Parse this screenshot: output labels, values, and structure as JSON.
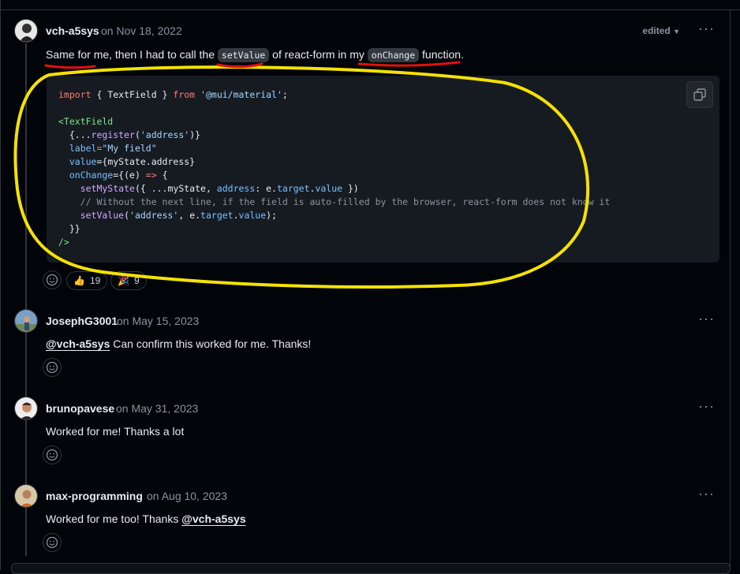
{
  "comments": [
    {
      "author": "vch-a5sys",
      "date": "on Nov 18, 2022",
      "edited_label": "edited",
      "more": "···",
      "body": {
        "part1": "Same for me",
        "part2": ", then I had to call the ",
        "code1": "setValue",
        "part3": " of react-form in my ",
        "code2": "onChange",
        "part4": " function."
      },
      "code_lines": {
        "l1_kw": "import",
        "l1_mid": " { TextField } ",
        "l1_from": "from",
        "l1_str": "'@mui/material'",
        "l1_end": ";",
        "l3": "<TextField",
        "l4_a": "  {...",
        "l4_fn": "register",
        "l4_b": "(",
        "l4_str": "'address'",
        "l4_c": ")}",
        "l5_prop": "  label",
        "l5_eq": "=",
        "l5_str": "\"My field\"",
        "l6_prop": "  value",
        "l6_rest": "={myState.address}",
        "l7_prop": "  onChange",
        "l7_rest": "={(e) ",
        "l7_arrow": "=>",
        "l7_end": " {",
        "l8_fn": "    setMyState",
        "l8_a": "({ ...myState, ",
        "l8_prop": "address",
        "l8_b": ": e.",
        "l8_prop2": "target",
        "l8_c": ".",
        "l8_prop3": "value",
        "l8_d": " })",
        "l9": "    // Without the next line, if the field is auto-filled by the browser, react-form does not know it",
        "l10_fn": "    setValue",
        "l10_a": "(",
        "l10_str": "'address'",
        "l10_b": ", e.",
        "l10_prop": "target",
        "l10_c": ".",
        "l10_prop2": "value",
        "l10_d": ");",
        "l11": "  }}",
        "l12": "/>"
      },
      "reactions": [
        {
          "emoji": "👍",
          "count": "19"
        },
        {
          "emoji": "🎉",
          "count": "9"
        }
      ]
    },
    {
      "author": "JosephG3001",
      "date": "on May 15, 2023",
      "more": "···",
      "mention": "@vch-a5sys",
      "text": " Can confirm this worked for me. Thanks!"
    },
    {
      "author": "brunopavese",
      "date": "on May 31, 2023",
      "more": "···",
      "text": "Worked for me! Thanks a lot"
    },
    {
      "author": "max-programming",
      "date": "on Aug 10, 2023",
      "more": "···",
      "text": "Worked for me too! Thanks ",
      "mention": "@vch-a5sys"
    }
  ],
  "colors": {
    "background": "#010409",
    "annotation_yellow": "#f5e200",
    "annotation_red": "#e01010"
  },
  "icons": [
    "smiley-icon",
    "copy-icon",
    "chevron-down-icon",
    "kebab-icon"
  ]
}
